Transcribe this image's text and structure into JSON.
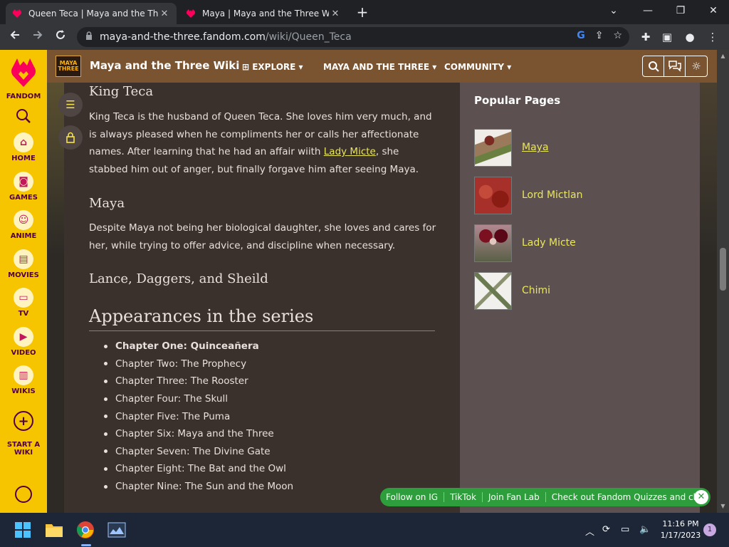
{
  "tabs": [
    {
      "title": "Queen Teca | Maya and the Three",
      "close": "✕"
    },
    {
      "title": "Maya | Maya and the Three Wiki",
      "close": "✕"
    }
  ],
  "window": {
    "minimize": "⌄",
    "min": "—",
    "restore": "❐",
    "close": "✕",
    "new_tab": "+"
  },
  "address": {
    "host": "maya-and-the-three.fandom.com",
    "path": "/wiki/Queen_Teca"
  },
  "fandom_rail": {
    "logo_text": "FANDOM",
    "items": [
      {
        "label": "HOME"
      },
      {
        "label": "GAMES"
      },
      {
        "label": "ANIME"
      },
      {
        "label": "MOVIES"
      },
      {
        "label": "TV"
      },
      {
        "label": "VIDEO"
      },
      {
        "label": "WIKIS"
      },
      {
        "label": "START A\nWIKI"
      }
    ]
  },
  "wiki_header": {
    "logo_text": "MAYA THREE",
    "name": "Maya and the Three Wiki",
    "nav": [
      "EXPLORE",
      "MAYA AND THE THREE",
      "COMMUNITY"
    ]
  },
  "article": {
    "section1_title": "King Teca",
    "section1_pre": "King Teca is the husband of Queen Teca. She loves him very much, and is always pleased when he compliments her or calls her affectionate names. After learning that he had an affair wiith ",
    "section1_link": "Lady Micte",
    "section1_post": ", she stabbed him out of anger, but finally forgave him after seeing Maya.",
    "section2_title": "Maya",
    "section2_text": "Despite Maya not being her biological daughter, she loves and cares for her, while trying to offer advice, and discipline when necessary.",
    "section3_title": "Lance, Daggers, and Sheild",
    "appearances_title": "Appearances in the series",
    "chapters": [
      "Chapter One: Quinceañera",
      "Chapter Two: The Prophecy",
      "Chapter Three: The Rooster",
      "Chapter Four: The Skull",
      "Chapter Five: The Puma",
      "Chapter Six: Maya and the Three",
      "Chapter Seven: The Divine Gate",
      "Chapter Eight: The Bat and the Owl",
      "Chapter Nine: The Sun and the Moon"
    ]
  },
  "popular": {
    "title": "Popular Pages",
    "items": [
      {
        "label": "Maya"
      },
      {
        "label": "Lord Mictlan"
      },
      {
        "label": "Lady Micte"
      },
      {
        "label": "Chimi"
      }
    ]
  },
  "fanbar": [
    "Follow on IG",
    "TikTok",
    "Join Fan Lab",
    "Check out Fandom Quizzes and cha"
  ],
  "taskbar": {
    "time": "11:16 PM",
    "date": "1/17/2023",
    "notifications": "1"
  },
  "colors": {
    "link": "#e9e65a",
    "fandom_yellow": "#f7c500",
    "header_brown": "#7a5330",
    "fanbar_green": "#2e9d3b"
  }
}
